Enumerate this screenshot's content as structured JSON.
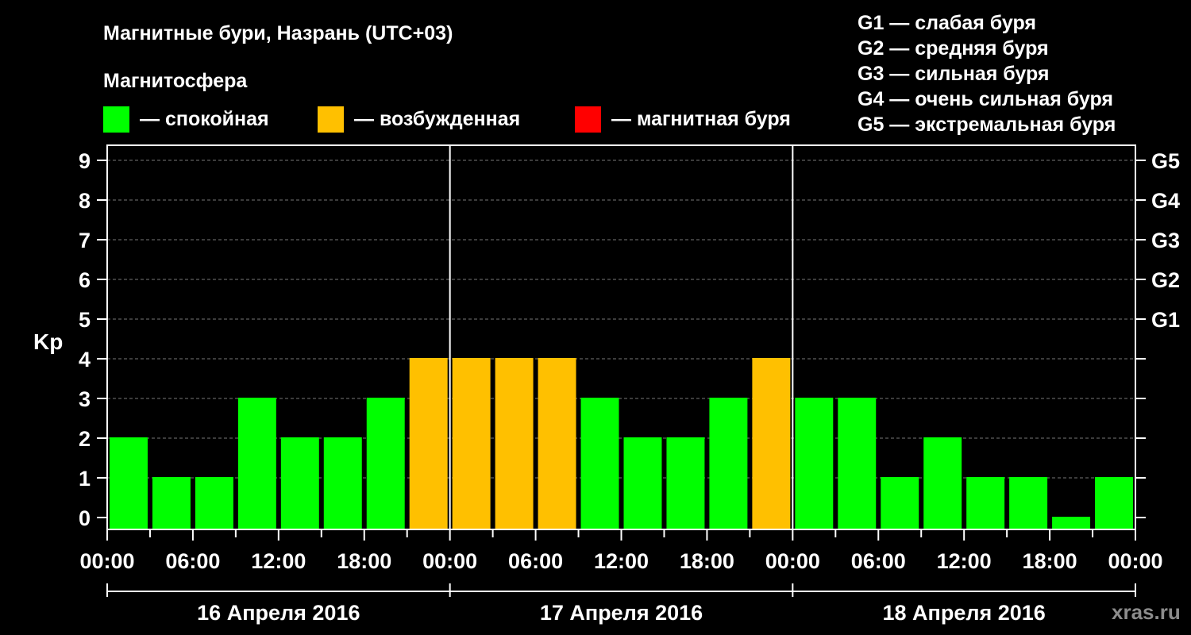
{
  "title": "Магнитные бури, Назрань (UTC+03)",
  "legend_heading": "Магнитосфера",
  "legend": [
    {
      "color": "#00ff00",
      "label": "— спокойная"
    },
    {
      "color": "#ffc000",
      "label": "— возбужденная"
    },
    {
      "color": "#ff0000",
      "label": "— магнитная буря"
    }
  ],
  "storm_scale": [
    "G1 — слабая буря",
    "G2 — средняя буря",
    "G3 — сильная буря",
    "G4 — очень сильная буря",
    "G5 — экстремальная буря"
  ],
  "watermark": "xras.ru",
  "chart_data": {
    "type": "bar",
    "ylabel": "Kp",
    "ylim": [
      0,
      9
    ],
    "yticks": [
      "0",
      "1",
      "2",
      "3",
      "4",
      "5",
      "6",
      "7",
      "8",
      "9"
    ],
    "right_ticks": [
      {
        "value": 5,
        "label": "G1"
      },
      {
        "value": 6,
        "label": "G2"
      },
      {
        "value": 7,
        "label": "G3"
      },
      {
        "value": 8,
        "label": "G4"
      },
      {
        "value": 9,
        "label": "G5"
      }
    ],
    "x_tick_labels": [
      "00:00",
      "06:00",
      "12:00",
      "18:00",
      "00:00",
      "06:00",
      "12:00",
      "18:00",
      "00:00",
      "06:00",
      "12:00",
      "18:00",
      "00:00"
    ],
    "days": [
      "16 Апреля 2016",
      "17 Апреля 2016",
      "18 Апреля 2016"
    ],
    "bar_interval_hours": 3,
    "values": [
      2,
      1,
      1,
      3,
      2,
      2,
      3,
      4,
      4,
      4,
      4,
      3,
      2,
      2,
      3,
      4,
      3,
      3,
      1,
      2,
      1,
      1,
      0,
      1
    ],
    "colors": {
      "quiet": "#00ff00",
      "active": "#ffc000",
      "storm": "#ff0000"
    },
    "grid": true
  }
}
